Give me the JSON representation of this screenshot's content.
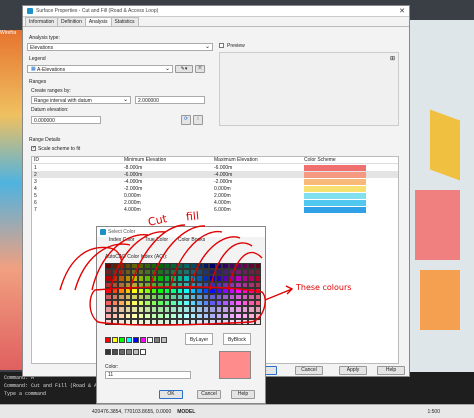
{
  "background": {
    "side_label": "Wirefra",
    "command_lines": [
      "Command:  A",
      "Command: Cut and Fill (Road & Acce",
      "Type a command"
    ],
    "status": {
      "coords": "420476.3854, 770103.8655, 0.0000",
      "model": "MODEL",
      "scale": "1:500"
    }
  },
  "dialog": {
    "title": "Surface Properties - Cut and Fill (Road & Access Loop)",
    "tabs": [
      "Information",
      "Definition",
      "Analysis",
      "Statistics"
    ],
    "analysis_type_label": "Analysis type:",
    "analysis_type_value": "Elevations",
    "legend_label": "Legend",
    "legend_value": "A-Elevations",
    "preview_label": "Preview",
    "ranges_label": "Ranges",
    "create_ranges_label": "Create ranges by:",
    "create_ranges_value": "Range interval with datum",
    "interval_value": "2.000000",
    "datum_label": "Datum elevation:",
    "datum_value": "0.000000",
    "range_details_label": "Range Details",
    "scale_scheme_label": "Scale scheme to fit",
    "table": {
      "headers": [
        "ID",
        "Minimum Elevation",
        "Maximum Elevation",
        "Color Scheme"
      ],
      "rows": [
        {
          "id": "1",
          "min": "-8.000m",
          "max": "-6.000m",
          "color": "#f07070"
        },
        {
          "id": "2",
          "min": "-6.000m",
          "max": "-4.000m",
          "color": "#f59a80"
        },
        {
          "id": "3",
          "min": "-4.000m",
          "max": "-2.000m",
          "color": "#f8b878"
        },
        {
          "id": "4",
          "min": "-2.000m",
          "max": "0.000m",
          "color": "#f8e070"
        },
        {
          "id": "5",
          "min": "0.000m",
          "max": "2.000m",
          "color": "#80e0f0"
        },
        {
          "id": "6",
          "min": "2.000m",
          "max": "4.000m",
          "color": "#50c8f0"
        },
        {
          "id": "7",
          "min": "4.000m",
          "max": "6.000m",
          "color": "#30a0e8"
        }
      ]
    },
    "buttons": {
      "ok": "OK",
      "cancel": "Cancel",
      "apply": "Apply",
      "help": "Help"
    }
  },
  "color_dialog": {
    "title": "Select Color",
    "tabs": [
      "Index Color",
      "True Color",
      "Color Books"
    ],
    "aci_label": "AutoCAD Color Index (ACI):",
    "bylayer": "ByLayer",
    "byblock": "ByBlock",
    "color_label": "Color:",
    "color_value": "11",
    "preview_color": "#ff8c8c",
    "buttons": {
      "ok": "OK",
      "cancel": "Cancel",
      "help": "Help"
    }
  },
  "annotations": {
    "cut": "Cut",
    "fill": "fill",
    "these_colours": "These colours"
  }
}
